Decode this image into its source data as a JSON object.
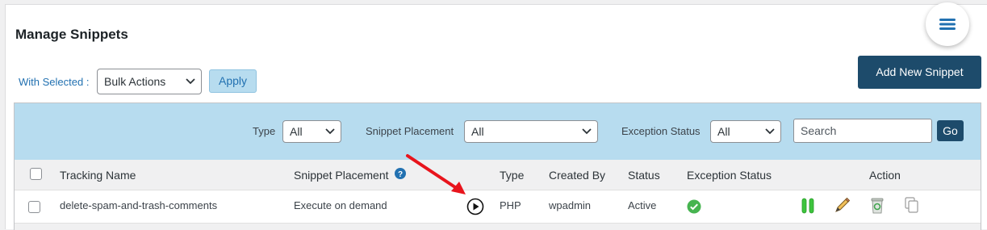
{
  "page": {
    "title": "Manage Snippets"
  },
  "bulk": {
    "with_selected_label": "With Selected :",
    "bulk_actions_value": "Bulk Actions",
    "apply_label": "Apply"
  },
  "actions": {
    "add_new_label": "Add New Snippet"
  },
  "filters": {
    "type_label": "Type",
    "type_value": "All",
    "placement_label": "Snippet Placement",
    "placement_value": "All",
    "exception_label": "Exception Status",
    "exception_value": "All",
    "search_placeholder": "Search",
    "go_label": "Go"
  },
  "table": {
    "headers": {
      "tracking_name": "Tracking Name",
      "snippet_placement": "Snippet Placement",
      "type": "Type",
      "created_by": "Created By",
      "status": "Status",
      "exception_status": "Exception Status",
      "action": "Action"
    },
    "rows": [
      {
        "tracking_name": "delete-spam-and-trash-comments",
        "snippet_placement": "Execute on demand",
        "type": "PHP",
        "created_by": "wpadmin",
        "status": "Active"
      }
    ]
  },
  "icons": {
    "menu": "hamburger-menu-icon",
    "help": "question-circle-icon",
    "run": "play-circle-icon",
    "exception_ok": "check-circle-icon",
    "pause": "pause-icon",
    "edit": "pencil-icon",
    "delete": "recycle-bin-icon",
    "duplicate": "copy-icon",
    "annotation": "red-arrow-icon"
  },
  "colors": {
    "accent": "#2271b1",
    "primary_button": "#1d4b6b",
    "filter_bar": "#b7dcef",
    "success": "#46b450",
    "annotation": "#e8141c"
  }
}
